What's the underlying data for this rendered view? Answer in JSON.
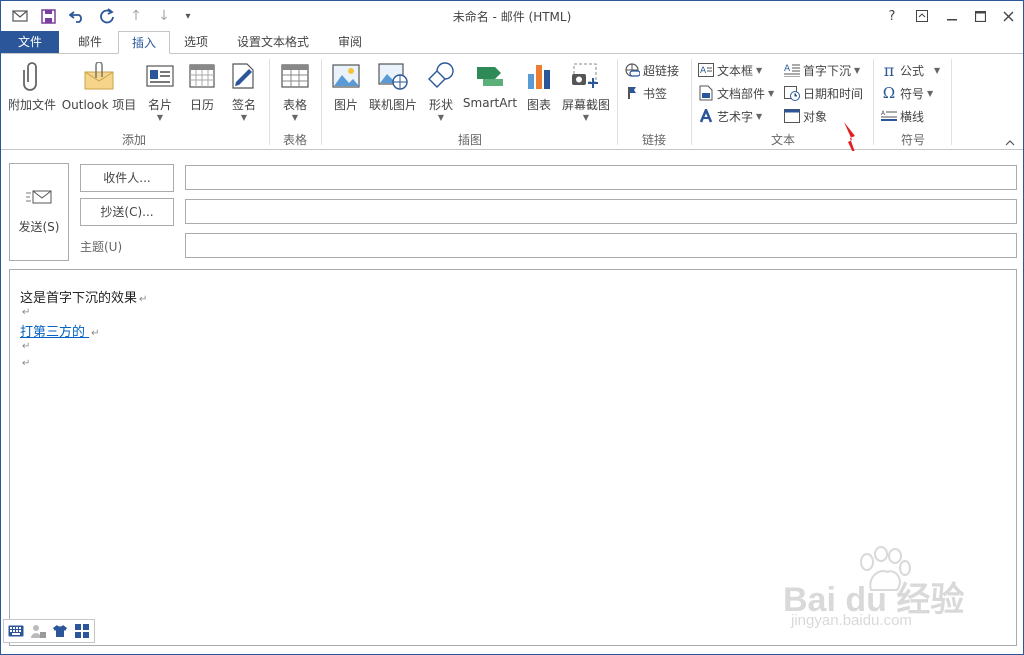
{
  "window": {
    "title": "未命名 - 邮件 (HTML)"
  },
  "window_controls": {
    "help": "?",
    "restore": "⧉",
    "minimize": "—",
    "maximize": "☐",
    "close": "✕"
  },
  "tabs": [
    {
      "label": "文件"
    },
    {
      "label": "邮件"
    },
    {
      "label": "插入"
    },
    {
      "label": "选项"
    },
    {
      "label": "设置文本格式"
    },
    {
      "label": "审阅"
    }
  ],
  "ribbon": {
    "add": {
      "group_label": "添加",
      "attach_file": "附加文件",
      "outlook_item": "Outlook 项目",
      "business_card": "名片",
      "calendar": "日历",
      "signature": "签名"
    },
    "tables": {
      "group_label": "表格",
      "table": "表格"
    },
    "illustrations": {
      "group_label": "插图",
      "pictures": "图片",
      "online_pictures": "联机图片",
      "shapes": "形状",
      "smartart": "SmartArt",
      "chart": "图表",
      "screenshot": "屏幕截图"
    },
    "links": {
      "group_label": "链接",
      "hyperlink": "超链接",
      "bookmark": "书签"
    },
    "text": {
      "group_label": "文本",
      "textbox": "文本框",
      "quick_parts": "文档部件",
      "wordart": "艺术字",
      "drop_cap": "首字下沉",
      "date_time": "日期和时间",
      "object": "对象"
    },
    "symbols": {
      "group_label": "符号",
      "equation": "公式",
      "symbol": "符号",
      "horizontal_line": "横线"
    }
  },
  "compose": {
    "send_label": "发送(S)",
    "to_label": "收件人...",
    "cc_label": "抄送(C)...",
    "subject_label": "主题(U)",
    "to_value": "",
    "cc_value": "",
    "subject_value": ""
  },
  "body": {
    "line1": "这是首字下沉的效果",
    "line3_link": "打第三方的 ",
    "para_mark": "↵"
  },
  "watermark": {
    "brand": "Bai du 经验",
    "url": "jingyan.baidu.com"
  },
  "colors": {
    "accent": "#2b579a",
    "link": "#0563c1",
    "annotation_arrow": "#e02020"
  }
}
